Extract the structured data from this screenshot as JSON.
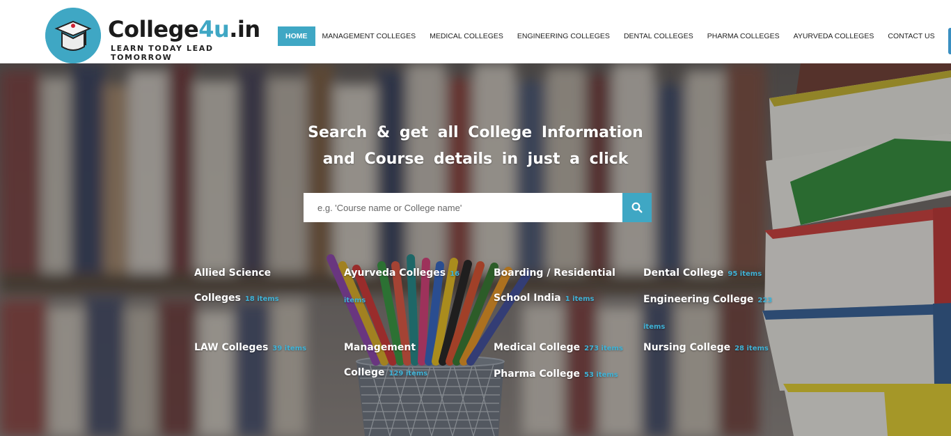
{
  "logo": {
    "name_main": "College",
    "name_accent": "4u",
    "name_suffix": ".in",
    "tagline": "LEARN TODAY LEAD TOMORROW"
  },
  "nav": [
    {
      "label": "HOME",
      "active": true
    },
    {
      "label": "MANAGEMENT COLLEGES"
    },
    {
      "label": "MEDICAL COLLEGES"
    },
    {
      "label": "ENGINEERING COLLEGES"
    },
    {
      "label": "DENTAL COLLEGES"
    },
    {
      "label": "PHARMA COLLEGES"
    },
    {
      "label": "AYURVEDA COLLEGES"
    },
    {
      "label": "CONTACT US"
    }
  ],
  "hero": {
    "headline_1": "Search & get all College Information",
    "headline_2": "and Course details in just a click",
    "search_placeholder": "e.g. 'Course name or College name'"
  },
  "categories": {
    "row1": [
      {
        "name": "Allied Science Colleges",
        "count": "18 items"
      },
      {
        "name": "Ayurveda Colleges",
        "count": "16 items"
      },
      {
        "name": "Boarding / Residential School India",
        "count": "1 items"
      },
      {
        "name": "Dental College",
        "count": "95 items"
      },
      {
        "name": "Engineering College",
        "count": "223 items"
      }
    ],
    "row2": [
      {
        "name": "LAW Colleges",
        "count": "39 items"
      },
      {
        "name": "Management College",
        "count": "129 items"
      },
      {
        "name": "Medical College",
        "count": "273 items"
      },
      {
        "name": "Pharma College",
        "count": "53 items"
      },
      {
        "name": "Nursing College",
        "count": "28 items"
      }
    ]
  },
  "colors": {
    "accent": "#3fa7c4",
    "count": "#3fb2d6"
  }
}
